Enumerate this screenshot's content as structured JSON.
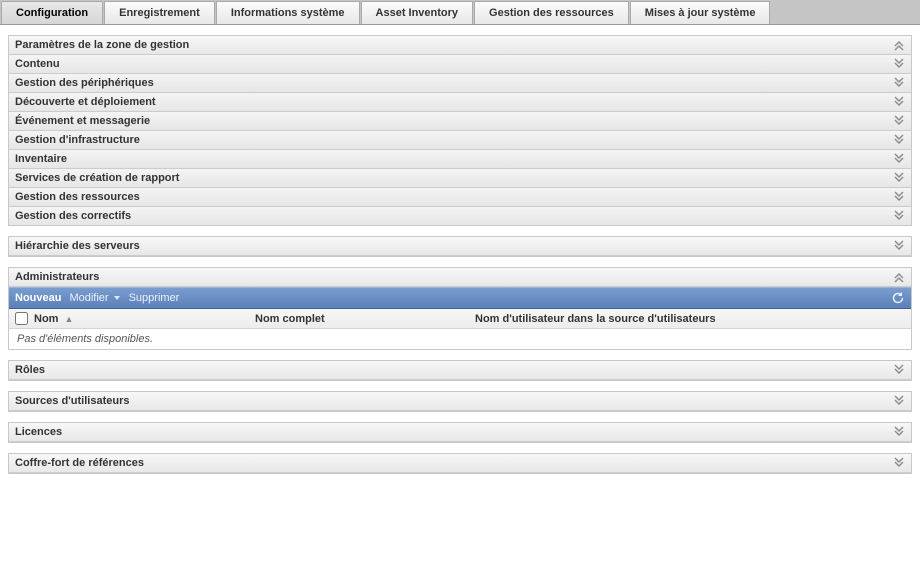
{
  "tabs": [
    {
      "label": "Configuration",
      "active": true
    },
    {
      "label": "Enregistrement",
      "active": false
    },
    {
      "label": "Informations système",
      "active": false
    },
    {
      "label": "Asset Inventory",
      "active": false
    },
    {
      "label": "Gestion des ressources",
      "active": false
    },
    {
      "label": "Mises à jour système",
      "active": false
    }
  ],
  "zone": {
    "title": "Paramètres de la zone de gestion",
    "items": [
      "Contenu",
      "Gestion des périphériques",
      "Découverte et déploiement",
      "Événement et messagerie",
      "Gestion d'infrastructure",
      "Inventaire",
      "Services de création de rapport",
      "Gestion des ressources",
      "Gestion des correctifs"
    ]
  },
  "hierarchy": {
    "title": "Hiérarchie des serveurs"
  },
  "admins": {
    "title": "Administrateurs",
    "toolbar": {
      "new": "Nouveau",
      "edit": "Modifier",
      "delete": "Supprimer"
    },
    "columns": {
      "name": "Nom",
      "fullname": "Nom complet",
      "username": "Nom d'utilisateur dans la source d'utilisateurs"
    },
    "empty": "Pas d'éléments disponibles."
  },
  "roles": {
    "title": "Rôles"
  },
  "usersources": {
    "title": "Sources d'utilisateurs"
  },
  "licenses": {
    "title": "Licences"
  },
  "vault": {
    "title": "Coffre-fort de références"
  }
}
